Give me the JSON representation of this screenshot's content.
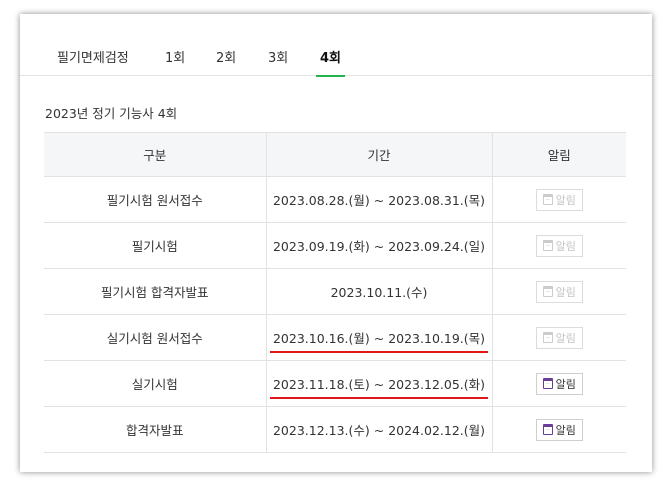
{
  "tabs": [
    {
      "label": "필기면제검정",
      "active": false
    },
    {
      "label": "1회",
      "active": false
    },
    {
      "label": "2회",
      "active": false
    },
    {
      "label": "3회",
      "active": false
    },
    {
      "label": "4회",
      "active": true
    }
  ],
  "exam_title": "2023년 정기 기능사 4회",
  "table": {
    "headers": [
      "구분",
      "기간",
      "알림"
    ],
    "rows": [
      {
        "category": "필기시험 원서접수",
        "period": "2023.08.28.(월) ~ 2023.08.31.(목)",
        "alarm": "알림",
        "alarm_enabled": false,
        "highlight": false
      },
      {
        "category": "필기시험",
        "period": "2023.09.19.(화) ~ 2023.09.24.(일)",
        "alarm": "알림",
        "alarm_enabled": false,
        "highlight": false
      },
      {
        "category": "필기시험 합격자발표",
        "period": "2023.10.11.(수)",
        "alarm": "알림",
        "alarm_enabled": false,
        "highlight": false
      },
      {
        "category": "실기시험 원서접수",
        "period": "2023.10.16.(월) ~ 2023.10.19.(목)",
        "alarm": "알림",
        "alarm_enabled": false,
        "highlight": true
      },
      {
        "category": "실기시험",
        "period": "2023.11.18.(토) ~ 2023.12.05.(화)",
        "alarm": "알림",
        "alarm_enabled": true,
        "highlight": true
      },
      {
        "category": "합격자발표",
        "period": "2023.12.13.(수) ~ 2024.02.12.(월)",
        "alarm": "알림",
        "alarm_enabled": true,
        "highlight": false
      }
    ]
  },
  "colors": {
    "active_tab_underline": "#22b14c",
    "highlight_underline": "#e01818",
    "calendar_icon": "#6a3d9a"
  },
  "icons": {
    "alarm": "calendar-icon"
  }
}
